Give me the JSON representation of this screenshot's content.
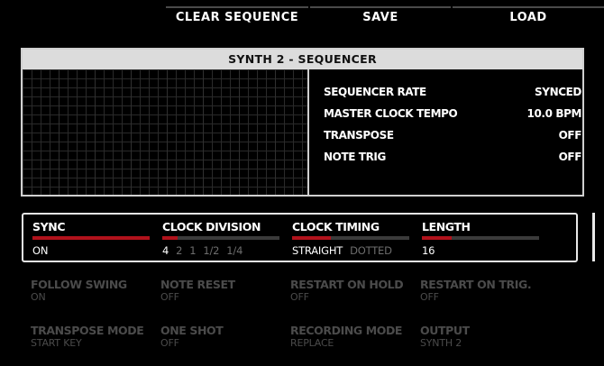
{
  "toolbar": {
    "clear_label": "CLEAR SEQUENCE",
    "save_label": "SAVE",
    "load_label": "LOAD"
  },
  "panel": {
    "title": "SYNTH 2 - SEQUENCER",
    "params": [
      {
        "label": "SEQUENCER RATE",
        "value": "SYNCED"
      },
      {
        "label": "MASTER CLOCK TEMPO",
        "value": "10.0 BPM"
      },
      {
        "label": "TRANSPOSE",
        "value": "OFF"
      },
      {
        "label": "NOTE TRIG",
        "value": "OFF"
      }
    ]
  },
  "controls": {
    "sync": {
      "label": "SYNC",
      "value": "ON",
      "level": 1.0
    },
    "clock_division": {
      "label": "CLOCK DIVISION",
      "options": [
        "4",
        "2",
        "1",
        "1/2",
        "1/4"
      ],
      "selected": "4",
      "level": 0.13
    },
    "clock_timing": {
      "label": "CLOCK TIMING",
      "options": [
        "STRAIGHT",
        "DOTTED"
      ],
      "selected": "STRAIGHT",
      "level": 0.33
    },
    "length": {
      "label": "LENGTH",
      "value": "16",
      "level": 0.25
    }
  },
  "row2": [
    {
      "label": "FOLLOW SWING",
      "value": "ON"
    },
    {
      "label": "NOTE RESET",
      "value": "OFF"
    },
    {
      "label": "RESTART ON HOLD",
      "value": "OFF"
    },
    {
      "label": "RESTART ON TRIG.",
      "value": "OFF"
    }
  ],
  "row3": [
    {
      "label": "TRANSPOSE MODE",
      "value": "START KEY"
    },
    {
      "label": "ONE SHOT",
      "value": "OFF"
    },
    {
      "label": "RECORDING MODE",
      "value": "REPLACE"
    },
    {
      "label": "OUTPUT",
      "value": "SYNTH 2"
    }
  ],
  "colors": {
    "accent": "#b1121b",
    "track": "#3b3b3b",
    "dim_text": "#4b4b4b"
  }
}
